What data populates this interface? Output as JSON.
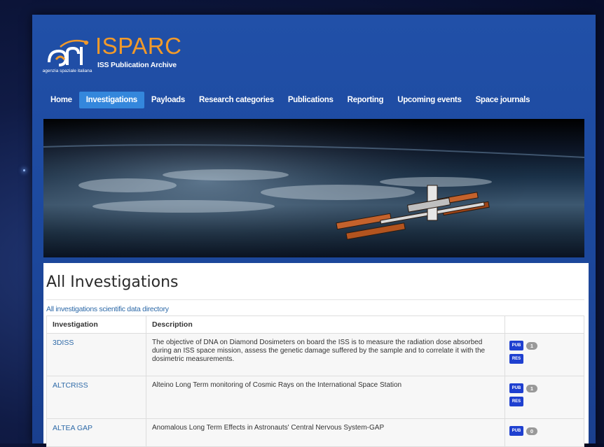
{
  "header": {
    "logo_small_text": "agenzia spaziale italiana",
    "title": "ISPARC",
    "subtitle": "ISS Publication Archive"
  },
  "nav": {
    "items": [
      {
        "label": "Home"
      },
      {
        "label": "Investigations",
        "active": true
      },
      {
        "label": "Payloads"
      },
      {
        "label": "Research categories"
      },
      {
        "label": "Publications"
      },
      {
        "label": "Reporting"
      },
      {
        "label": "Upcoming events"
      },
      {
        "label": "Space journals"
      }
    ]
  },
  "main": {
    "title": "All Investigations",
    "directory_link": "All investigations scientific data directory",
    "table": {
      "columns": [
        "Investigation",
        "Description",
        ""
      ],
      "rows": [
        {
          "name": "3DISS",
          "description": "The objective of DNA on Diamond Dosimeters on board the ISS is to measure the radiation dose absorbed during an ISS space mission, assess the genetic damage suffered by the sample and to correlate it with the dosimetric measurements.",
          "pub_label": "PUB",
          "pub_count": "1",
          "res_label": "RES"
        },
        {
          "name": "ALTCRISS",
          "description": "Alteino Long Term monitoring of Cosmic Rays on the International Space Station",
          "pub_label": "PUB",
          "pub_count": "1",
          "res_label": "RES"
        },
        {
          "name": "ALTEA GAP",
          "description": "Anomalous Long Term Effects in Astronauts' Central Nervous System-GAP",
          "pub_label": "PUB",
          "pub_count": "0"
        }
      ]
    }
  },
  "colors": {
    "brand_orange": "#f29a2a",
    "frame_blue": "#1d4aa0",
    "nav_active": "#3487dc",
    "link_blue": "#2e6aa8",
    "badge_blue": "#1f40d0",
    "count_grey": "#999999"
  },
  "icons": [
    "asi-logo-icon"
  ]
}
